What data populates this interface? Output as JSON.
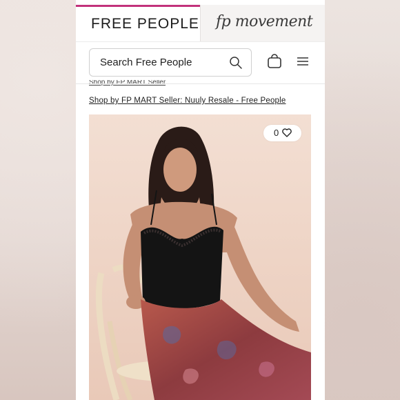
{
  "header": {
    "tab_free_people": "FREE PEOPLE",
    "tab_movement": "fp movement"
  },
  "search": {
    "placeholder": "Search Free People"
  },
  "icons": {
    "search": "search-icon",
    "bag": "shopping-bag-icon",
    "menu": "hamburger-menu-icon",
    "heart": "heart-icon"
  },
  "content": {
    "clipped_link": "Shop by FP MART Seller",
    "shop_link": "Shop by FP MART Seller: Nuuly Resale - Free People"
  },
  "product": {
    "like_count": "0",
    "image_alt": "Model in black lace camisole and floral satin skirt"
  },
  "colors": {
    "accent": "#c2317b",
    "photo_bg": "#f0d9cc",
    "top": "#141414",
    "skirt": "#9b3f3a"
  }
}
